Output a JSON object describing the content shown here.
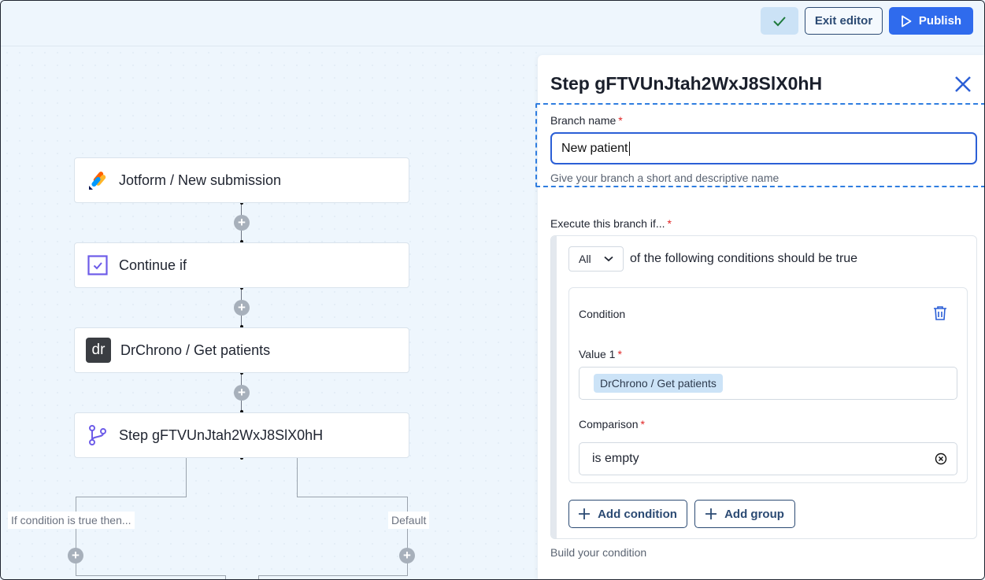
{
  "toolbar": {
    "exit_label": "Exit editor",
    "publish_label": "Publish"
  },
  "flow": {
    "nodes": [
      {
        "label": "Jotform / New submission",
        "icon": "jotform-icon"
      },
      {
        "label": "Continue if",
        "icon": "checkbox-icon"
      },
      {
        "label": "DrChrono / Get patients",
        "icon": "drchrono-icon",
        "icon_text": "dr"
      },
      {
        "label": "Step gFTVUnJtah2WxJ8SlX0hH",
        "icon": "branch-icon"
      }
    ],
    "branch_true_label": "If condition is true then...",
    "branch_default_label": "Default"
  },
  "panel": {
    "title": "Step gFTVUnJtah2WxJ8SlX0hH",
    "branch_name_label": "Branch name",
    "required_mark": "*",
    "branch_name_value": "New patient",
    "branch_name_hint": "Give your branch a short and descriptive name",
    "execute_label": "Execute this branch if...",
    "match_select": "All",
    "match_text": "of the following conditions should be true",
    "condition": {
      "title": "Condition",
      "value1_label": "Value 1",
      "value1_chip": "DrChrono / Get patients",
      "comparison_label": "Comparison",
      "comparison_value": "is empty"
    },
    "add_condition_label": "Add condition",
    "add_group_label": "Add group",
    "build_hint": "Build your condition"
  },
  "colors": {
    "accent": "#2f6bed",
    "canvas_bg": "#eef6fd",
    "required": "#e02424",
    "chip_bg": "#cce3f7"
  }
}
